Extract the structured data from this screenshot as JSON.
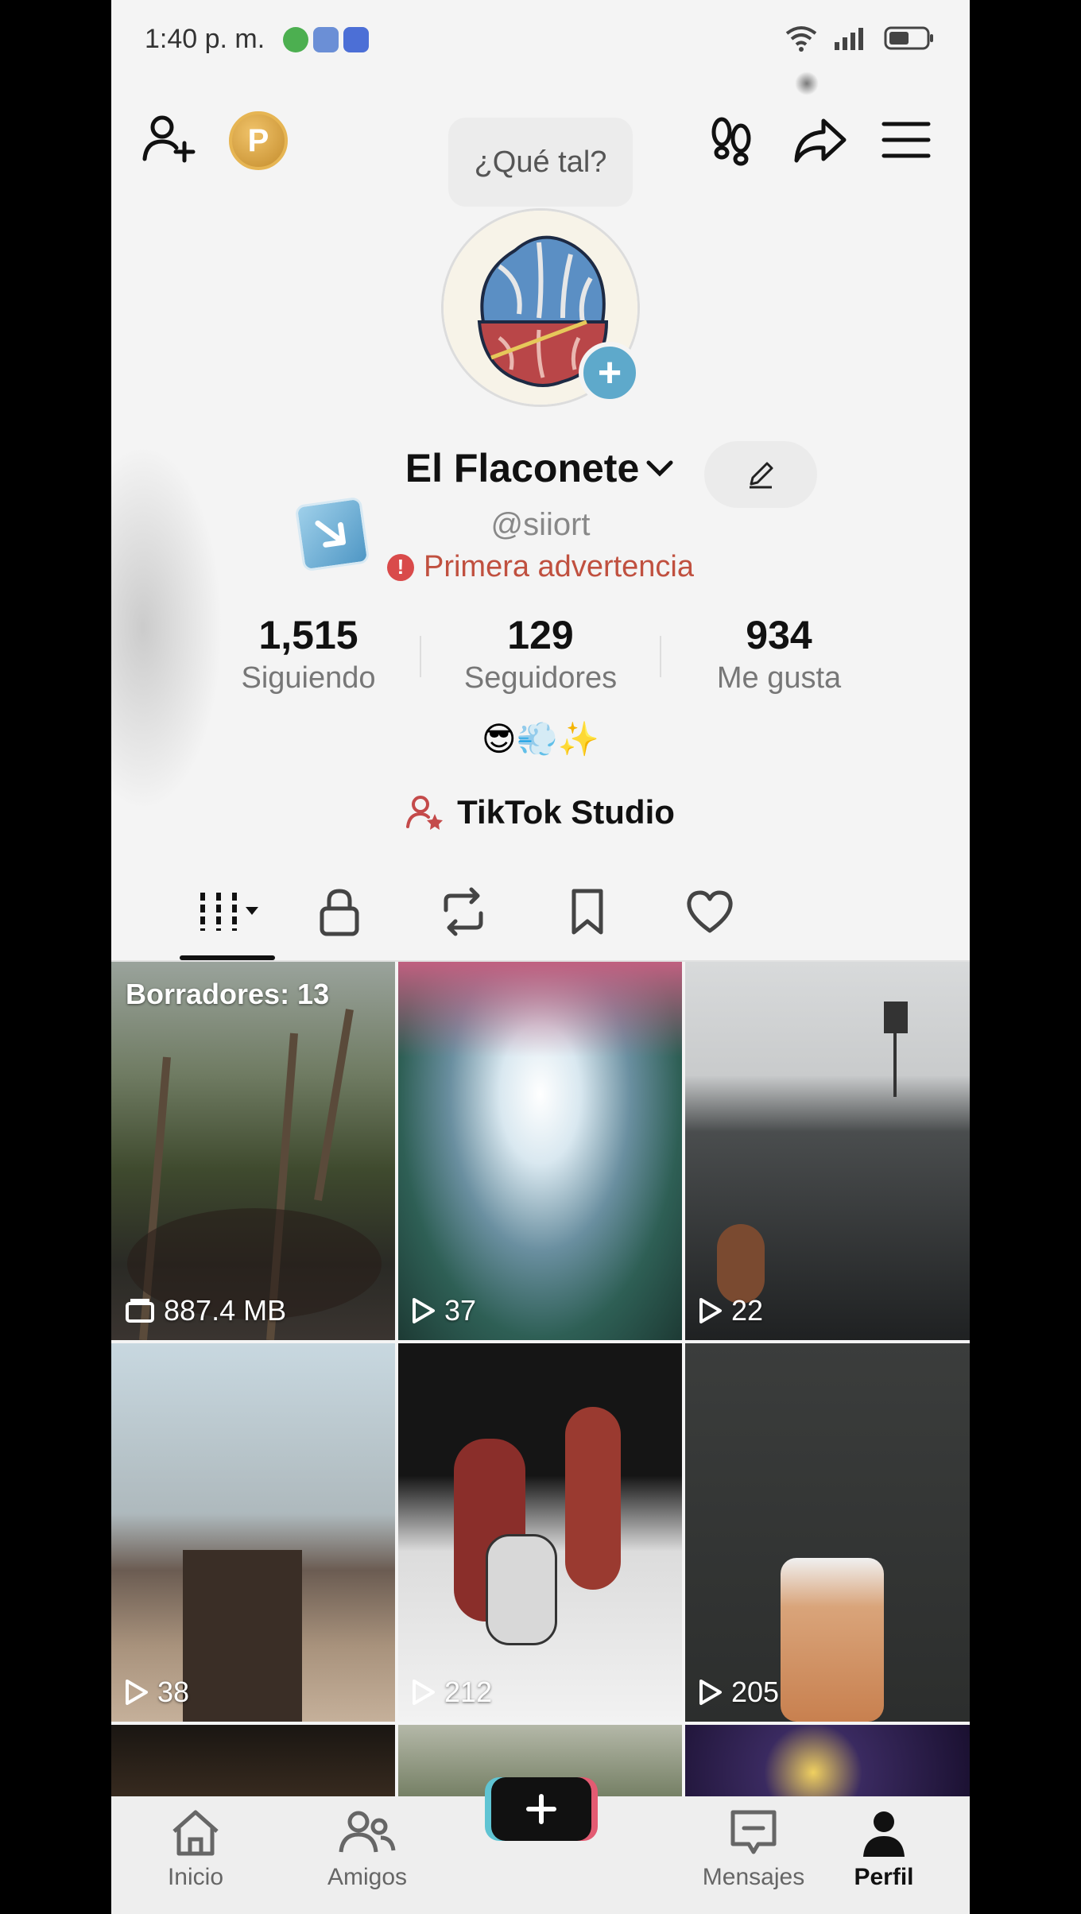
{
  "status_bar": {
    "time": "1:40 p. m.",
    "notification_icons": [
      "whatsapp-icon",
      "pinwheel-icon",
      "app-icon"
    ],
    "system_icons": [
      "wifi-icon",
      "signal-icon",
      "battery-icon"
    ]
  },
  "header": {
    "add_friend_icon": "person-plus-icon",
    "coin_label": "P",
    "footprints_icon": "footprints-icon",
    "share_icon": "share-icon",
    "menu_icon": "hamburger-menu-icon"
  },
  "profile": {
    "note_bubble": "¿Qué tal?",
    "display_name": "El Flaconete",
    "username": "@siiort",
    "warning_text": "Primera advertencia",
    "bio_emojis": "😎💨✨",
    "studio_label": "TikTok Studio"
  },
  "stats": [
    {
      "value": "1,515",
      "label": "Siguiendo"
    },
    {
      "value": "129",
      "label": "Seguidores"
    },
    {
      "value": "934",
      "label": "Me gusta"
    }
  ],
  "tabs": [
    {
      "name": "videos-tab",
      "icon": "grid-columns-icon",
      "active": true
    },
    {
      "name": "private-tab",
      "icon": "lock-icon",
      "active": false
    },
    {
      "name": "reposts-tab",
      "icon": "repost-icon",
      "active": false
    },
    {
      "name": "favorites-tab",
      "icon": "bookmark-icon",
      "active": false
    },
    {
      "name": "liked-tab",
      "icon": "heart-icon",
      "active": false
    }
  ],
  "grid": {
    "drafts_label": "Borradores: 13",
    "drafts_size": "887.4 MB",
    "videos": [
      {
        "views": "37"
      },
      {
        "views": "22"
      },
      {
        "views": "38"
      },
      {
        "views": "212"
      },
      {
        "views": "205"
      }
    ]
  },
  "bottom_nav": [
    {
      "label": "Inicio",
      "icon": "home-icon"
    },
    {
      "label": "Amigos",
      "icon": "friends-icon"
    },
    {
      "label": "",
      "icon": "plus-icon"
    },
    {
      "label": "Mensajes",
      "icon": "inbox-icon"
    },
    {
      "label": "Perfil",
      "icon": "profile-icon"
    }
  ],
  "colors": {
    "warning": "#c0503f",
    "avatar_plus": "#5ea9cb",
    "create_left": "#5fc4d3",
    "create_right": "#e35b72"
  }
}
